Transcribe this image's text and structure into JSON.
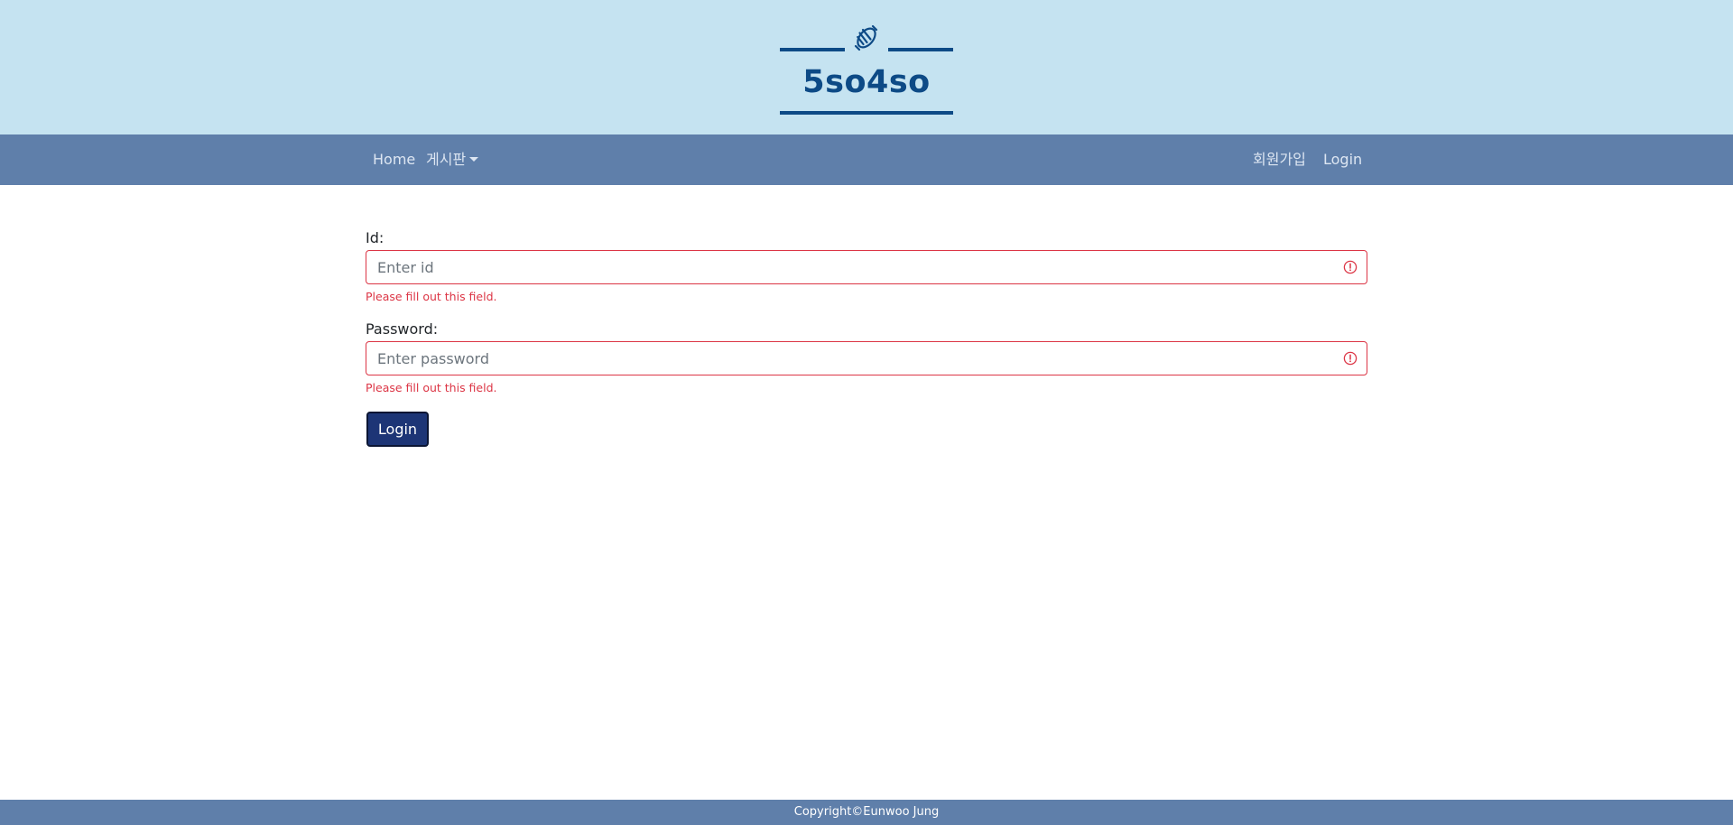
{
  "brand": {
    "title": "5so4so",
    "icon": "croissant-icon",
    "color": "#0d4a86",
    "header_background": "#c5e3f1"
  },
  "navbar": {
    "background": "#5f7faa",
    "left": {
      "home": "Home",
      "board": "게시판"
    },
    "right": {
      "signup": "회원가입",
      "login": "Login"
    }
  },
  "form": {
    "id": {
      "label": "Id:",
      "placeholder": "Enter id",
      "value": "",
      "feedback": "Please fill out this field."
    },
    "password": {
      "label": "Password:",
      "placeholder": "Enter password",
      "value": "",
      "feedback": "Please fill out this field."
    },
    "submit_label": "Login",
    "invalid_color": "#dc3545",
    "button_color": "#1d3576"
  },
  "footer": {
    "text": "Copyright©Eunwoo Jung"
  }
}
